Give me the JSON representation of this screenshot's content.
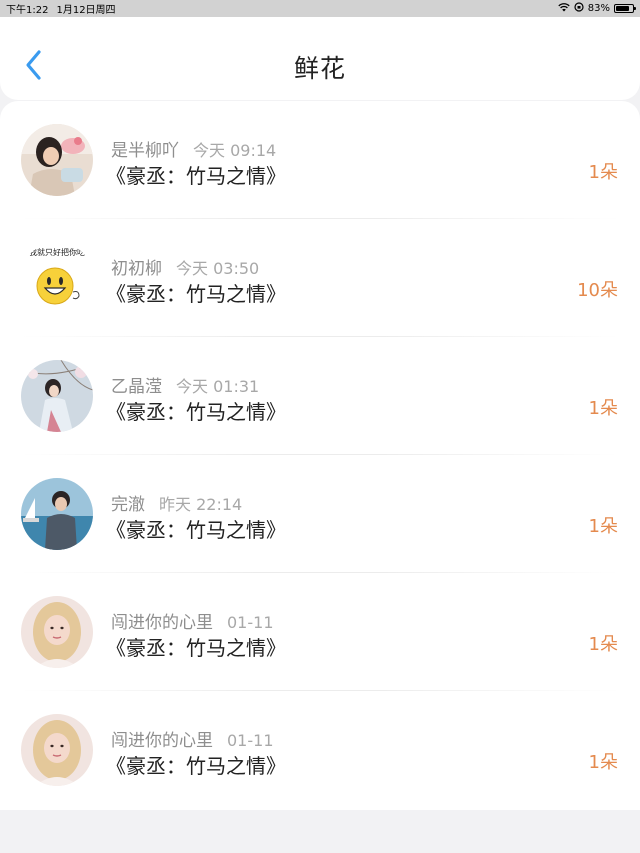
{
  "status_bar": {
    "time": "下午1:22",
    "date": "1月12日周四",
    "battery": "83%",
    "battery_level": 0.83
  },
  "header": {
    "title": "鲜花",
    "back_icon": "chevron-left-icon",
    "accent_color": "#3a9bef"
  },
  "items": [
    {
      "name": "是半柳吖",
      "time": "今天 09:14",
      "gift": "《豪丞：竹马之情》",
      "count": "1朵",
      "avatar": "photo-girl-pink"
    },
    {
      "name": "初初柳",
      "time": "今天 03:50",
      "gift": "《豪丞：竹马之情》",
      "count": "10朵",
      "avatar": "emoji-smiley",
      "avatar_caption": "我就只好把你吃"
    },
    {
      "name": "乙晶滢",
      "time": "今天 01:31",
      "gift": "《豪丞：竹马之情》",
      "count": "1朵",
      "avatar": "photo-girl-blossom"
    },
    {
      "name": "完澈",
      "time": "昨天 22:14",
      "gift": "《豪丞：竹马之情》",
      "count": "1朵",
      "avatar": "photo-boy-sea"
    },
    {
      "name": "闯进你的心里",
      "time": "01-11",
      "gift": "《豪丞：竹马之情》",
      "count": "1朵",
      "avatar": "photo-blonde"
    },
    {
      "name": "闯进你的心里",
      "time": "01-11",
      "gift": "《豪丞：竹马之情》",
      "count": "1朵",
      "avatar": "photo-blonde"
    }
  ],
  "colors": {
    "count": "#e48a4e",
    "name": "#8e8e8e",
    "gift": "#222222"
  }
}
